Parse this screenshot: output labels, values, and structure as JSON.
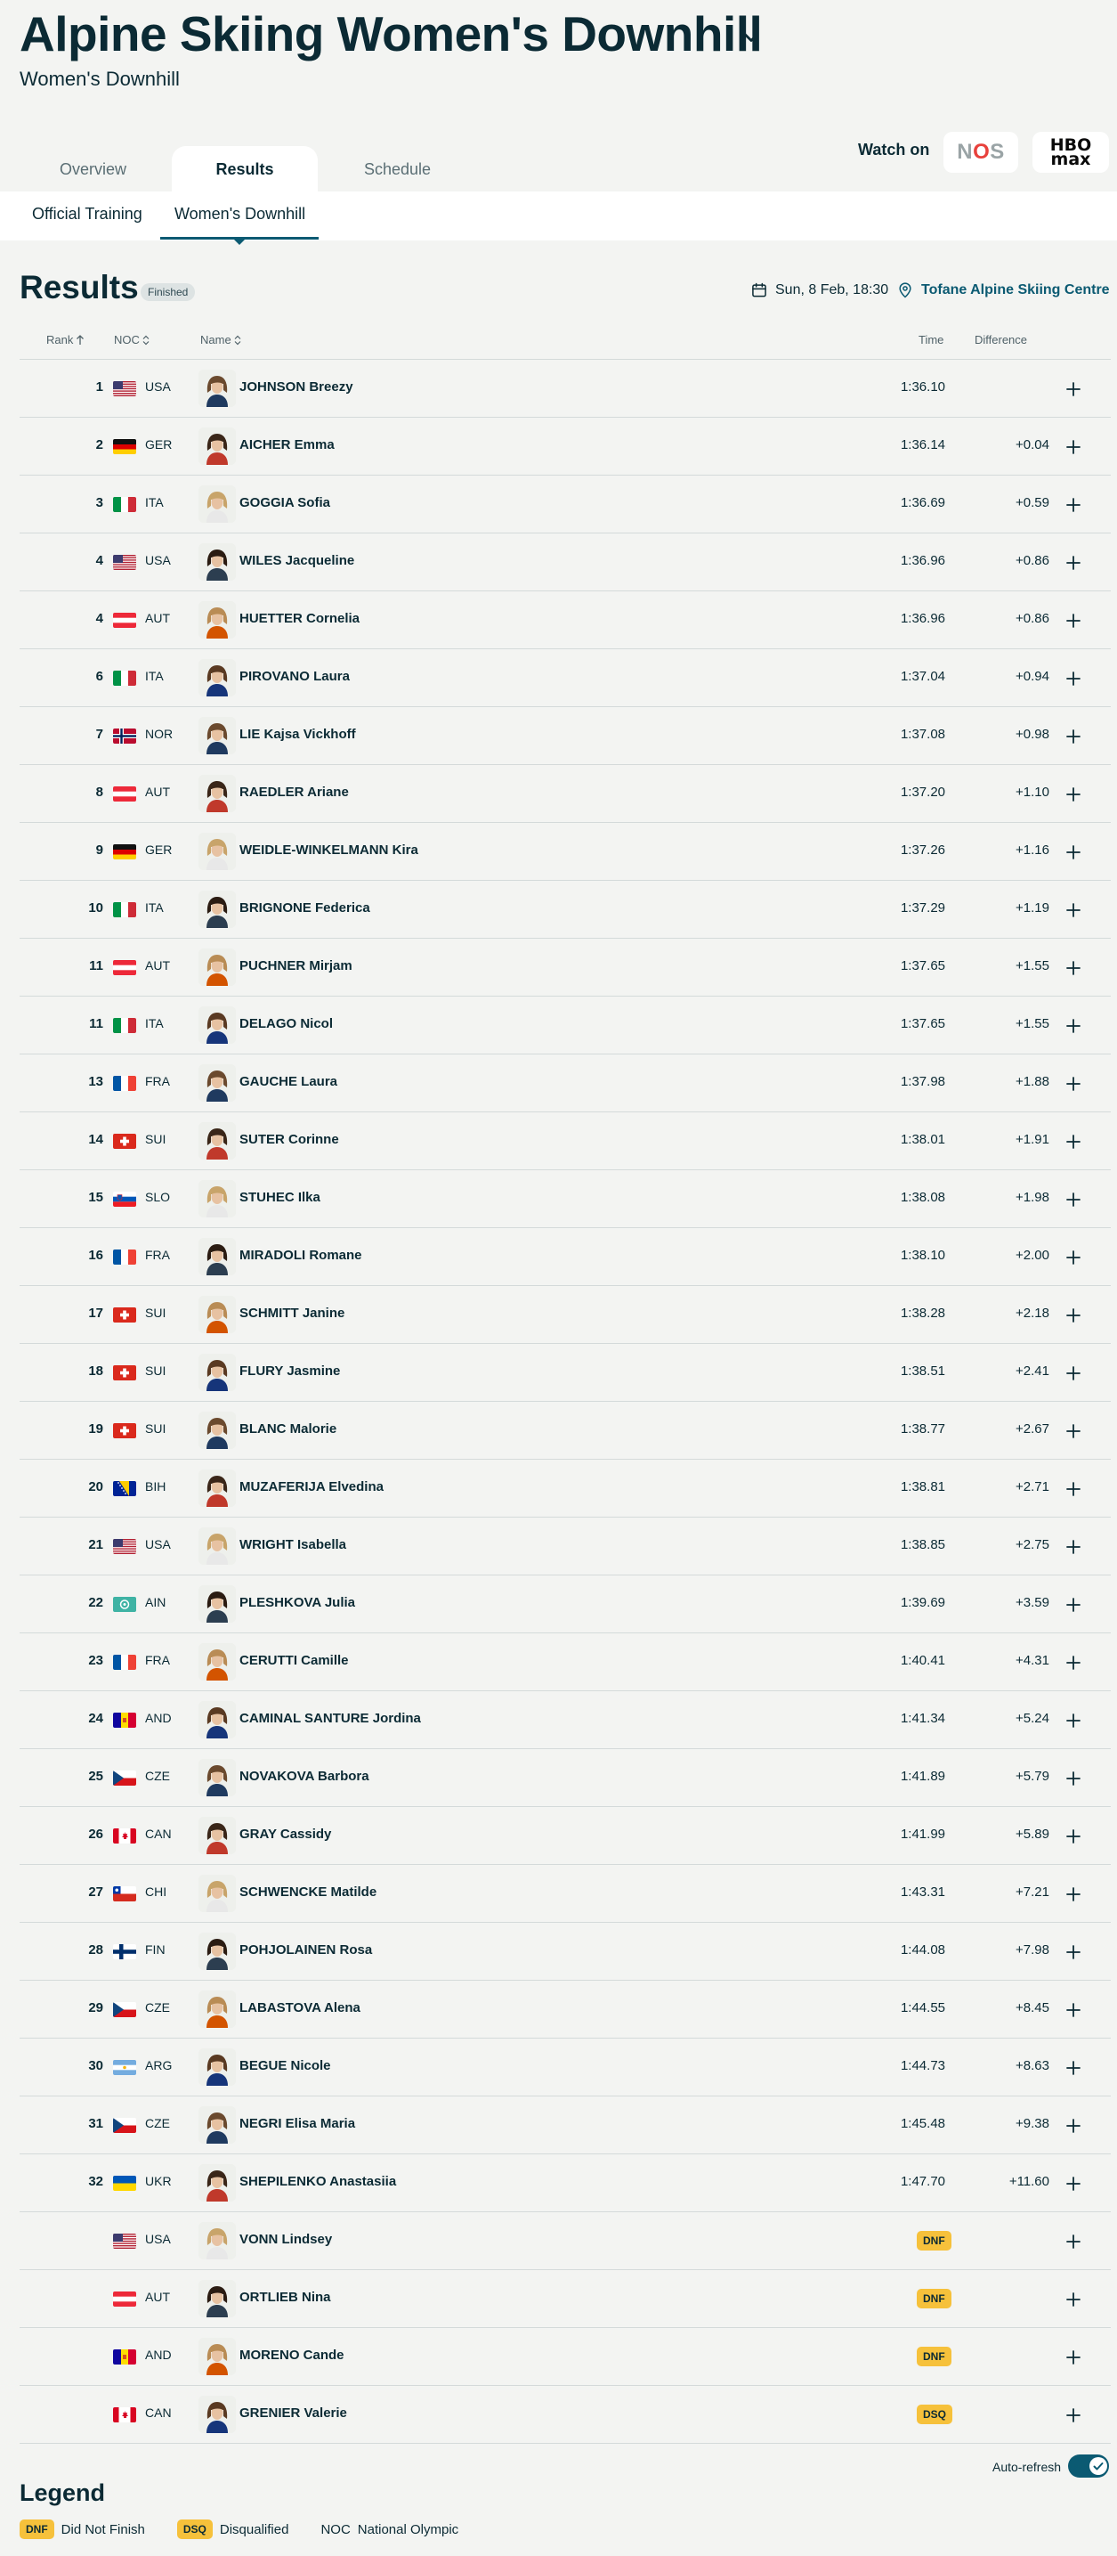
{
  "header": {
    "title": "Alpine Skiing Women's Downhill",
    "subtitle": "Women's Downhill"
  },
  "tabs": [
    {
      "label": "Overview",
      "active": false
    },
    {
      "label": "Results",
      "active": true
    },
    {
      "label": "Schedule",
      "active": false
    }
  ],
  "watch": {
    "label": "Watch on",
    "providers": [
      "NOS",
      "HBO max"
    ]
  },
  "subtabs": [
    {
      "label": "Official Training",
      "active": false
    },
    {
      "label": "Women's Downhill",
      "active": true
    }
  ],
  "results": {
    "heading": "Results",
    "status_badge": "Finished",
    "date": "Sun, 8 Feb, 18:30",
    "venue": "Tofane Alpine Skiing Centre",
    "columns": {
      "rank": "Rank",
      "noc": "NOC",
      "name": "Name",
      "time": "Time",
      "difference": "Difference"
    },
    "rows": [
      {
        "rank": "1",
        "noc": "USA",
        "name": "JOHNSON Breezy",
        "time": "1:36.10",
        "diff": ""
      },
      {
        "rank": "2",
        "noc": "GER",
        "name": "AICHER Emma",
        "time": "1:36.14",
        "diff": "+0.04"
      },
      {
        "rank": "3",
        "noc": "ITA",
        "name": "GOGGIA Sofia",
        "time": "1:36.69",
        "diff": "+0.59"
      },
      {
        "rank": "4",
        "noc": "USA",
        "name": "WILES Jacqueline",
        "time": "1:36.96",
        "diff": "+0.86"
      },
      {
        "rank": "4",
        "noc": "AUT",
        "name": "HUETTER Cornelia",
        "time": "1:36.96",
        "diff": "+0.86"
      },
      {
        "rank": "6",
        "noc": "ITA",
        "name": "PIROVANO Laura",
        "time": "1:37.04",
        "diff": "+0.94"
      },
      {
        "rank": "7",
        "noc": "NOR",
        "name": "LIE Kajsa Vickhoff",
        "time": "1:37.08",
        "diff": "+0.98"
      },
      {
        "rank": "8",
        "noc": "AUT",
        "name": "RAEDLER Ariane",
        "time": "1:37.20",
        "diff": "+1.10"
      },
      {
        "rank": "9",
        "noc": "GER",
        "name": "WEIDLE-WINKELMANN Kira",
        "time": "1:37.26",
        "diff": "+1.16"
      },
      {
        "rank": "10",
        "noc": "ITA",
        "name": "BRIGNONE Federica",
        "time": "1:37.29",
        "diff": "+1.19"
      },
      {
        "rank": "11",
        "noc": "AUT",
        "name": "PUCHNER Mirjam",
        "time": "1:37.65",
        "diff": "+1.55"
      },
      {
        "rank": "11",
        "noc": "ITA",
        "name": "DELAGO Nicol",
        "time": "1:37.65",
        "diff": "+1.55"
      },
      {
        "rank": "13",
        "noc": "FRA",
        "name": "GAUCHE Laura",
        "time": "1:37.98",
        "diff": "+1.88"
      },
      {
        "rank": "14",
        "noc": "SUI",
        "name": "SUTER Corinne",
        "time": "1:38.01",
        "diff": "+1.91"
      },
      {
        "rank": "15",
        "noc": "SLO",
        "name": "STUHEC Ilka",
        "time": "1:38.08",
        "diff": "+1.98"
      },
      {
        "rank": "16",
        "noc": "FRA",
        "name": "MIRADOLI Romane",
        "time": "1:38.10",
        "diff": "+2.00"
      },
      {
        "rank": "17",
        "noc": "SUI",
        "name": "SCHMITT Janine",
        "time": "1:38.28",
        "diff": "+2.18"
      },
      {
        "rank": "18",
        "noc": "SUI",
        "name": "FLURY Jasmine",
        "time": "1:38.51",
        "diff": "+2.41"
      },
      {
        "rank": "19",
        "noc": "SUI",
        "name": "BLANC Malorie",
        "time": "1:38.77",
        "diff": "+2.67"
      },
      {
        "rank": "20",
        "noc": "BIH",
        "name": "MUZAFERIJA Elvedina",
        "time": "1:38.81",
        "diff": "+2.71"
      },
      {
        "rank": "21",
        "noc": "USA",
        "name": "WRIGHT Isabella",
        "time": "1:38.85",
        "diff": "+2.75"
      },
      {
        "rank": "22",
        "noc": "AIN",
        "name": "PLESHKOVA Julia",
        "time": "1:39.69",
        "diff": "+3.59"
      },
      {
        "rank": "23",
        "noc": "FRA",
        "name": "CERUTTI Camille",
        "time": "1:40.41",
        "diff": "+4.31"
      },
      {
        "rank": "24",
        "noc": "AND",
        "name": "CAMINAL SANTURE Jordina",
        "time": "1:41.34",
        "diff": "+5.24"
      },
      {
        "rank": "25",
        "noc": "CZE",
        "name": "NOVAKOVA Barbora",
        "time": "1:41.89",
        "diff": "+5.79"
      },
      {
        "rank": "26",
        "noc": "CAN",
        "name": "GRAY Cassidy",
        "time": "1:41.99",
        "diff": "+5.89"
      },
      {
        "rank": "27",
        "noc": "CHI",
        "name": "SCHWENCKE Matilde",
        "time": "1:43.31",
        "diff": "+7.21"
      },
      {
        "rank": "28",
        "noc": "FIN",
        "name": "POHJOLAINEN Rosa",
        "time": "1:44.08",
        "diff": "+7.98"
      },
      {
        "rank": "29",
        "noc": "CZE",
        "name": "LABASTOVA Alena",
        "time": "1:44.55",
        "diff": "+8.45"
      },
      {
        "rank": "30",
        "noc": "ARG",
        "name": "BEGUE Nicole",
        "time": "1:44.73",
        "diff": "+8.63"
      },
      {
        "rank": "31",
        "noc": "CZE",
        "name": "NEGRI Elisa Maria",
        "time": "1:45.48",
        "diff": "+9.38"
      },
      {
        "rank": "32",
        "noc": "UKR",
        "name": "SHEPILENKO Anastasiia",
        "time": "1:47.70",
        "diff": "+11.60"
      },
      {
        "rank": "",
        "noc": "USA",
        "name": "VONN Lindsey",
        "time": "",
        "diff": "",
        "status": "DNF"
      },
      {
        "rank": "",
        "noc": "AUT",
        "name": "ORTLIEB Nina",
        "time": "",
        "diff": "",
        "status": "DNF"
      },
      {
        "rank": "",
        "noc": "AND",
        "name": "MORENO Cande",
        "time": "",
        "diff": "",
        "status": "DNF"
      },
      {
        "rank": "",
        "noc": "CAN",
        "name": "GRENIER Valerie",
        "time": "",
        "diff": "",
        "status": "DSQ"
      }
    ]
  },
  "auto_refresh": {
    "label": "Auto-refresh",
    "on": true
  },
  "legend": {
    "heading": "Legend",
    "items": [
      {
        "code": "DNF",
        "label": "Did Not Finish"
      },
      {
        "code": "DSQ",
        "label": "Disqualified"
      },
      {
        "code": "NOC",
        "label": "National Olympic"
      }
    ]
  },
  "colors": {
    "primary": "#0b2a34",
    "accent": "#0b5a72",
    "status_badge": "#f6c13b",
    "background": "#f3f4f2"
  }
}
